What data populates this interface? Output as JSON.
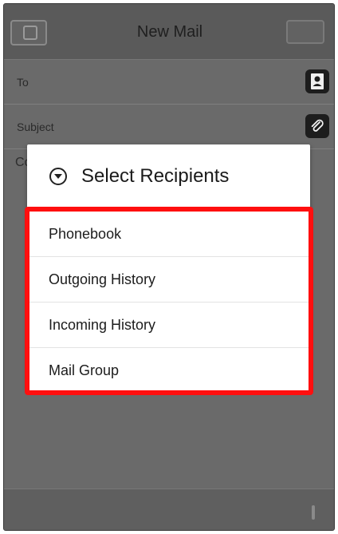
{
  "header": {
    "title": "New Mail"
  },
  "fields": {
    "to_label": "To",
    "subject_label": "Subject",
    "content_partial": "Co"
  },
  "dialog": {
    "title": "Select Recipients",
    "items": [
      "Phonebook",
      "Outgoing History",
      "Incoming History",
      "Mail Group"
    ]
  },
  "colors": {
    "highlight_border": "#ff0f0f",
    "overlay": "#6a6a6a"
  },
  "icons": {
    "back": "back-icon",
    "contacts": "contact-book-icon",
    "attach": "paperclip-icon",
    "expand": "chevron-down-circle-icon"
  }
}
